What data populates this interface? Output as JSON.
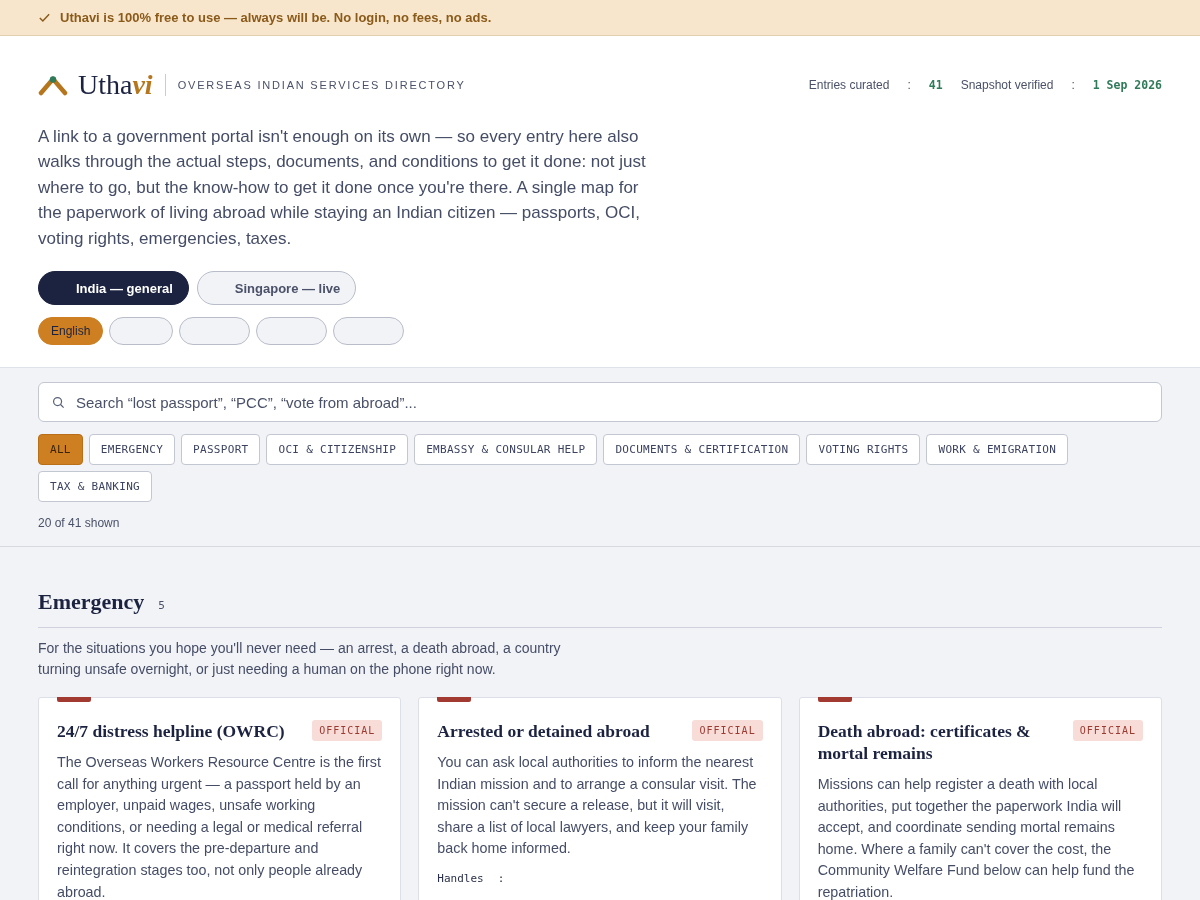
{
  "banner": {
    "text": "Uthavi is 100% free to use — always will be. No login, no fees, no ads."
  },
  "header": {
    "brand_main": "Utha",
    "brand_accent": "vi",
    "tagline": "OVERSEAS INDIAN SERVICES DIRECTORY",
    "stats": [
      {
        "label": "Entries curated",
        "separator": ":",
        "value": "41"
      },
      {
        "label": "Snapshot verified",
        "separator": ":",
        "value": "1 Sep 2026"
      }
    ]
  },
  "intro": "A link to a government portal isn't enough on its own — so every entry here also walks through the actual steps, documents, and conditions to get it done: not just where to go, but the know-how to get it done once you're there. A single map for the paperwork of living abroad while staying an Indian citizen — passports, OCI, voting rights, emergencies, taxes.",
  "regions": [
    {
      "label": "India — general",
      "selected": true
    },
    {
      "label": "Singapore — live",
      "selected": false
    }
  ],
  "languages": [
    {
      "label": "English",
      "selected": true
    },
    {
      "selected": false
    },
    {
      "selected": false
    },
    {
      "selected": false
    },
    {
      "selected": false
    }
  ],
  "search": {
    "placeholder": "Search “lost passport”, “PCC”, “vote from abroad”..."
  },
  "categories": [
    {
      "label": "ALL",
      "selected": true
    },
    {
      "label": "EMERGENCY",
      "selected": false
    },
    {
      "label": "PASSPORT",
      "selected": false
    },
    {
      "label": "OCI & CITIZENSHIP",
      "selected": false
    },
    {
      "label": "EMBASSY & CONSULAR HELP",
      "selected": false
    },
    {
      "label": "DOCUMENTS & CERTIFICATION",
      "selected": false
    },
    {
      "label": "VOTING RIGHTS",
      "selected": false
    },
    {
      "label": "WORK & EMIGRATION",
      "selected": false
    },
    {
      "label": "TAX & BANKING",
      "selected": false
    }
  ],
  "result_count": "20 of 41 shown",
  "section": {
    "title": "Emergency",
    "count": "5",
    "description": "For the situations you hope you'll never need — an arrest, a death abroad, a country turning unsafe overnight, or just needing a human on the phone right now.",
    "cards": [
      {
        "title": "24/7 distress helpline (OWRC)",
        "badge": "OFFICIAL",
        "body": "The Overseas Workers Resource Centre is the first call for anything urgent — a passport held by an employer, unpaid wages, unsafe working conditions, or needing a legal or medical referral right now. It covers the pre-departure and reintegration stages too, not only people already abroad."
      },
      {
        "title": "Arrested or detained abroad",
        "badge": "OFFICIAL",
        "body": "You can ask local authorities to inform the nearest Indian mission and to arrange a consular visit. The mission can't secure a release, but it will visit, share a list of local lawyers, and keep your family back home informed.",
        "handles_label": "Handles",
        "handles_separator": ":"
      },
      {
        "title": "Death abroad: certificates & mortal remains",
        "badge": "OFFICIAL",
        "body": "Missions can help register a death with local authorities, put together the paperwork India will accept, and coordinate sending mortal remains home. Where a family can't cover the cost, the Community Welfare Fund below can help fund the repatriation."
      }
    ]
  }
}
